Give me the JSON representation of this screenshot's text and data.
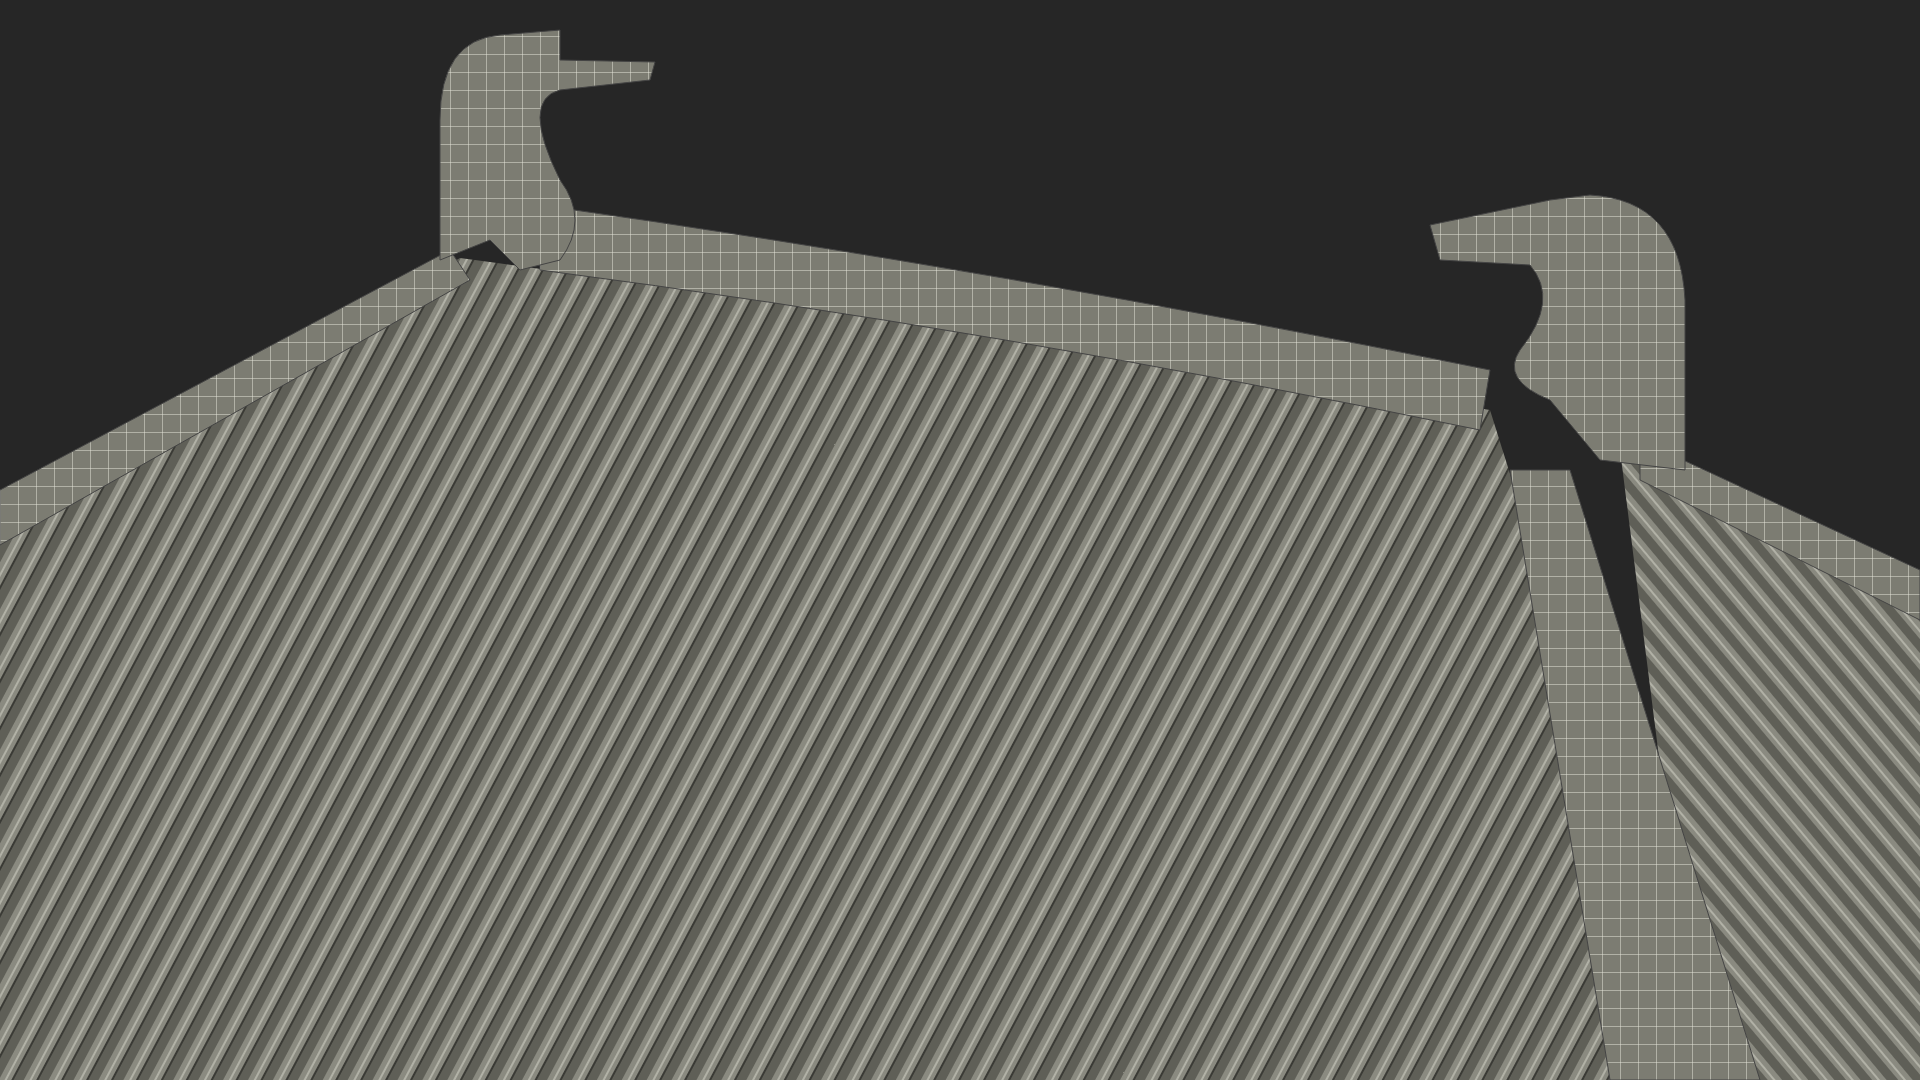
{
  "scene": {
    "kind": "render"
  }
}
